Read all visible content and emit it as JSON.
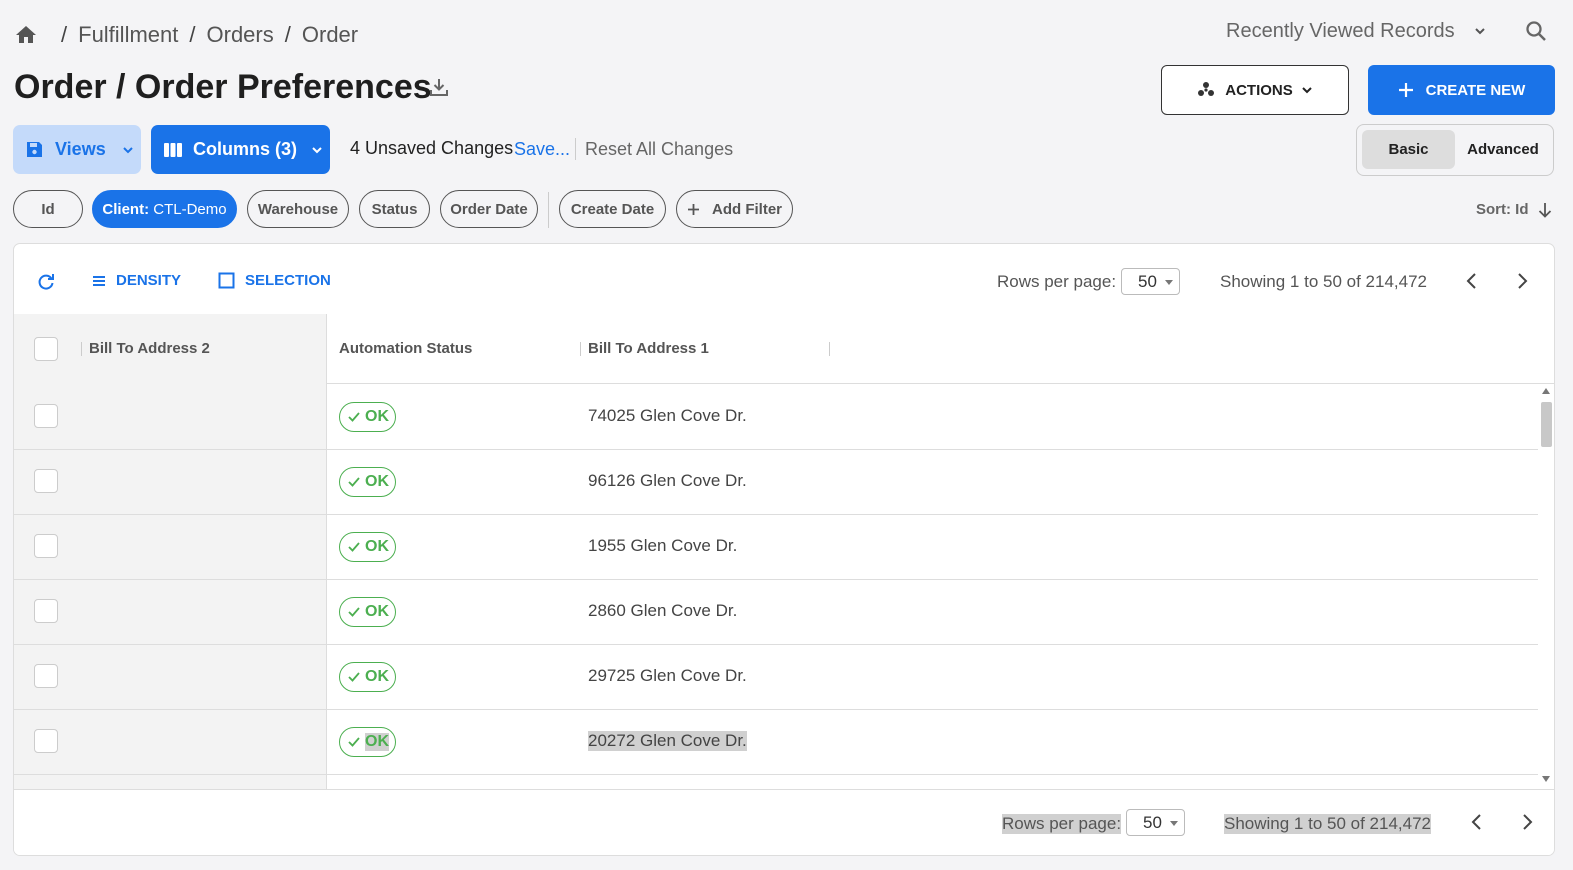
{
  "breadcrumb": {
    "items": [
      "Fulfillment",
      "Orders",
      "Order"
    ],
    "separator": "/"
  },
  "header": {
    "recently_viewed": "Recently Viewed Records",
    "title": "Order / Order Preferences",
    "actions_label": "ACTIONS",
    "create_label": "CREATE NEW"
  },
  "toolbar": {
    "views_label": "Views",
    "columns_label": "Columns (3)",
    "unsaved_text": "4 Unsaved Changes",
    "save_label": "Save...",
    "reset_label": "Reset All Changes",
    "mode_basic": "Basic",
    "mode_advanced": "Advanced",
    "selected_mode": "Basic"
  },
  "filters": {
    "chips": [
      {
        "label": "Id"
      },
      {
        "label_bold": "Client:",
        "label_value": " CTL-Demo",
        "active": true
      },
      {
        "label": "Warehouse"
      },
      {
        "label": "Status"
      },
      {
        "label": "Order Date"
      },
      {
        "label": "Create Date"
      }
    ],
    "add_filter": "Add Filter",
    "sort_label": "Sort: Id"
  },
  "grid": {
    "toolbar": {
      "density": "DENSITY",
      "selection": "SELECTION"
    },
    "pager": {
      "rows_per_page_label": "Rows per page:",
      "rows_per_page": "50",
      "showing": "Showing 1 to 50 of 214,472"
    },
    "columns": [
      "Bill To Address 2",
      "Automation Status",
      "Bill To Address 1"
    ],
    "rows": [
      {
        "bill_to_address_2": "",
        "automation_status": "OK",
        "bill_to_address_1": "74025 Glen Cove Dr."
      },
      {
        "bill_to_address_2": "",
        "automation_status": "OK",
        "bill_to_address_1": "96126 Glen Cove Dr."
      },
      {
        "bill_to_address_2": "",
        "automation_status": "OK",
        "bill_to_address_1": "1955 Glen Cove Dr."
      },
      {
        "bill_to_address_2": "",
        "automation_status": "OK",
        "bill_to_address_1": "2860 Glen Cove Dr."
      },
      {
        "bill_to_address_2": "",
        "automation_status": "OK",
        "bill_to_address_1": "29725 Glen Cove Dr."
      },
      {
        "bill_to_address_2": "",
        "automation_status": "OK",
        "bill_to_address_1": "20272 Glen Cove Dr."
      }
    ]
  },
  "icons": {
    "home": "home-icon",
    "search": "search-icon",
    "download": "download-icon",
    "actions": "actions-icon",
    "plus": "plus-icon",
    "save": "save-icon",
    "columns": "columns-icon",
    "refresh": "refresh-icon",
    "density": "density-icon",
    "selection": "checkbox-icon",
    "sort": "arrow-down-icon",
    "check": "check-icon"
  },
  "colors": {
    "primary": "#1a73e8",
    "views_bg": "#c4dafa",
    "ok_green": "#4caf50",
    "page_bg": "#f4f4f6"
  }
}
